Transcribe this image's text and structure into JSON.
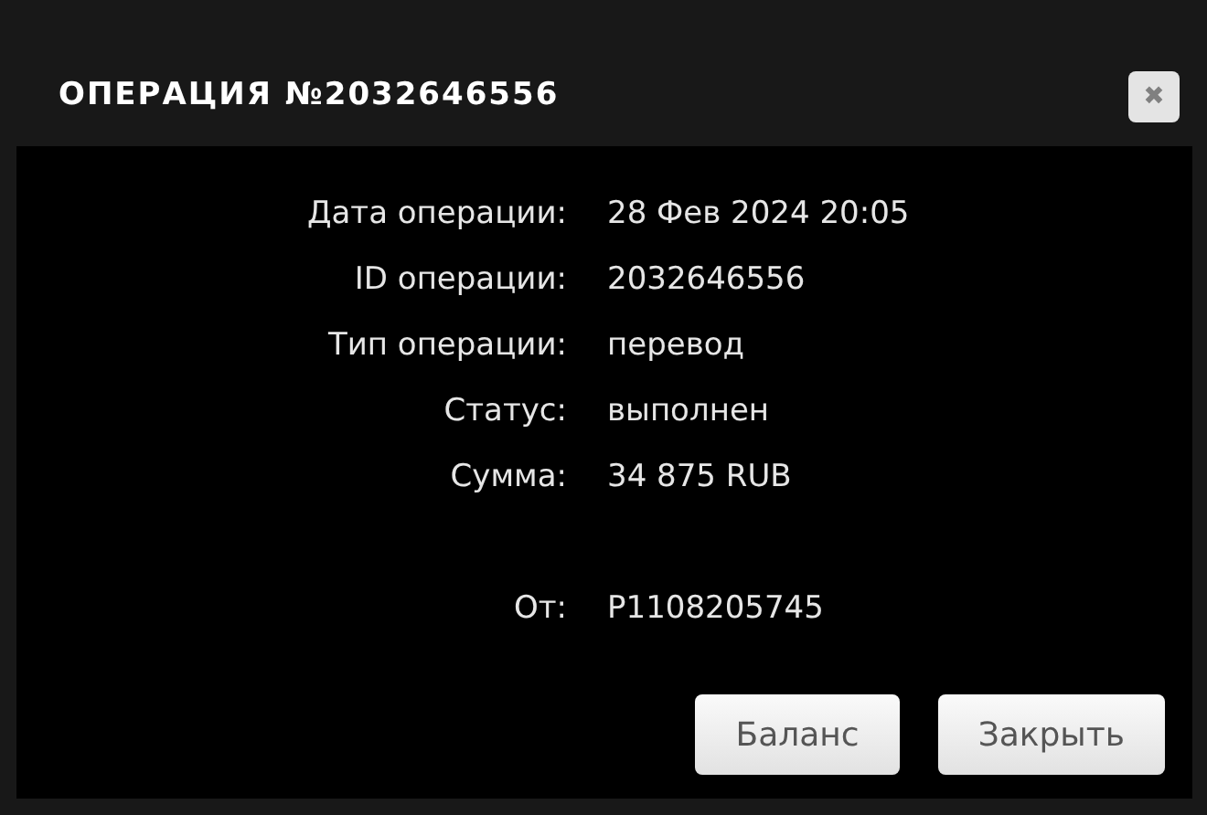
{
  "dialog": {
    "title": "ОПЕРАЦИЯ №2032646556",
    "close_icon": "✖"
  },
  "details": [
    {
      "label": "Дата операции:",
      "value": "28 Фев 2024 20:05"
    },
    {
      "label": "ID операции:",
      "value": "2032646556"
    },
    {
      "label": "Тип операции:",
      "value": "перевод"
    },
    {
      "label": "Статус:",
      "value": "выполнен"
    },
    {
      "label": "Сумма:",
      "value": "34 875 RUB"
    }
  ],
  "sender": {
    "label": "От:",
    "value": "P1108205745"
  },
  "buttons": [
    "Баланс",
    "Закрыть"
  ]
}
